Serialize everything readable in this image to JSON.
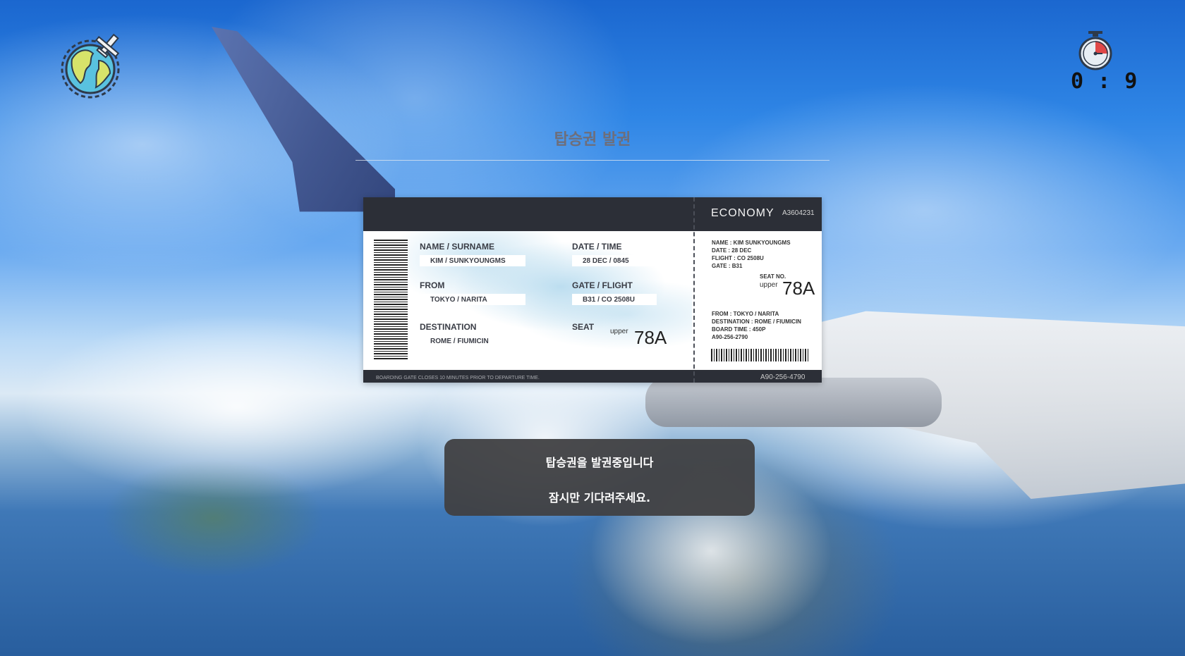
{
  "header": {
    "logo_icon": "globe-airplane-icon",
    "timer": {
      "icon": "stopwatch-icon",
      "display": "0 : 9"
    }
  },
  "title": "탑승권 발권",
  "ticket": {
    "class_label": "ECONOMY",
    "ticket_code": "A3604231",
    "fields": {
      "name_label": "NAME / SURNAME",
      "name_value": "KIM / SUNKYOUNGMS",
      "from_label": "FROM",
      "from_value": "TOKYO / NARITA",
      "destination_label": "DESTINATION",
      "destination_value": "ROME / FIUMICIN",
      "date_label": "DATE / TIME",
      "date_value": "28 DEC / 0845",
      "gate_label": "GATE / FLIGHT",
      "gate_value": "B31 / CO 2508U",
      "seat_label": "SEAT",
      "seat_upper": "upper",
      "seat_value": "78A"
    },
    "stub": {
      "name": "NAME : KIM SUNKYOUNGMS",
      "date": "DATE : 28 DEC",
      "flight": "FLIGHT : CO 2508U",
      "gate": "GATE : B31",
      "seat_no_label": "SEAT NO.",
      "seat_upper": "upper",
      "seat_value": "78A",
      "from": "FROM : TOKYO / NARITA",
      "destination": "DESTINATION : ROME / FIUMICIN",
      "board_time": "BOARD TIME : 450P",
      "ref": "A90-256-2790"
    },
    "footer_note": "BOARDING GATE CLOSES 10 MINUTES PRIOR TO DEPARTURE TIME.",
    "footer_code": "A90-256-4790"
  },
  "status": {
    "line1": "탑승권을 발권중입니다",
    "line2": "잠시만 기다려주세요."
  }
}
